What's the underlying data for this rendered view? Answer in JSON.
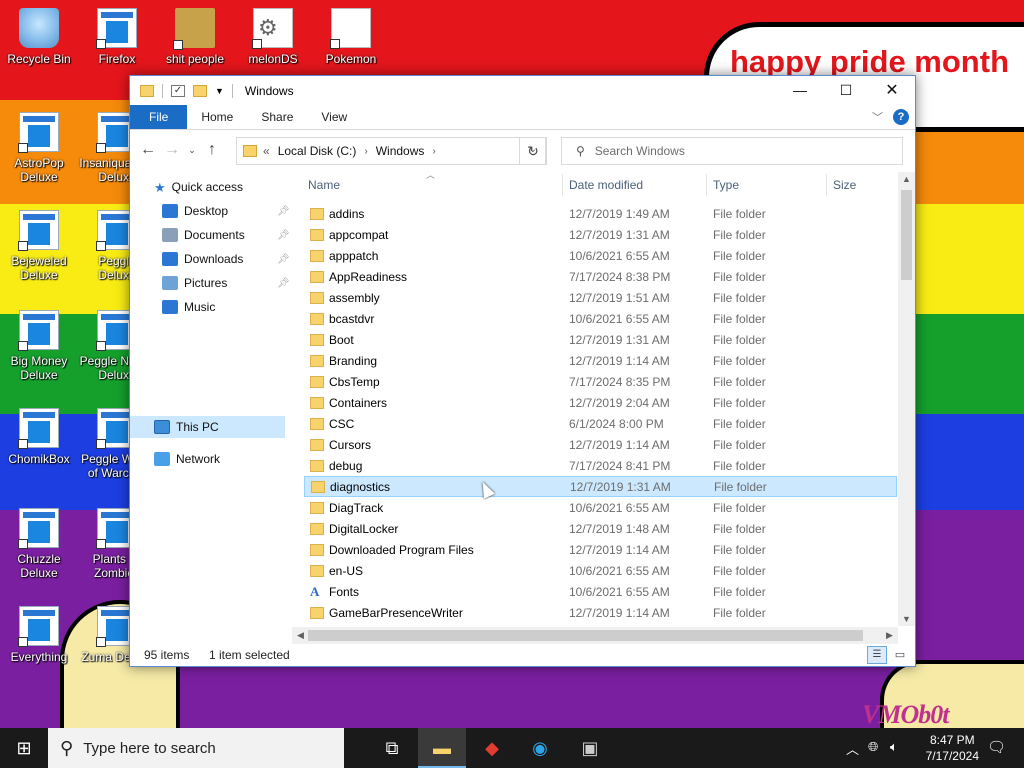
{
  "desktop": {
    "banner_text": "happy pride month",
    "watermark": "VMOb0t",
    "icons": [
      {
        "label": "Recycle Bin",
        "icon": "recycle-bin-icon"
      },
      {
        "label": "Firefox",
        "icon": "app-shortcut-icon"
      },
      {
        "label": "shit people",
        "icon": "folder-icon"
      },
      {
        "label": "melonDS",
        "icon": "gear-file-icon"
      },
      {
        "label": "Pokemon",
        "icon": "blank-file-icon"
      },
      {
        "label": "AstroPop\nDeluxe",
        "icon": "app-shortcut-icon"
      },
      {
        "label": "Insaniquarium\nDeluxe",
        "icon": "app-shortcut-icon"
      },
      {
        "label": "Bejeweled\nDeluxe",
        "icon": "app-shortcut-icon"
      },
      {
        "label": "Peggle\nDeluxe",
        "icon": "app-shortcut-icon"
      },
      {
        "label": "Big Money\nDeluxe",
        "icon": "app-shortcut-icon"
      },
      {
        "label": "Peggle Nights\nDeluxe",
        "icon": "app-shortcut-icon"
      },
      {
        "label": "ChomikBox",
        "icon": "app-shortcut-icon"
      },
      {
        "label": "Peggle World\nof Warcraft",
        "icon": "app-shortcut-icon"
      },
      {
        "label": "Chuzzle\nDeluxe",
        "icon": "app-shortcut-icon"
      },
      {
        "label": "Plants vs\nZombies",
        "icon": "app-shortcut-icon"
      },
      {
        "label": "Everything",
        "icon": "app-shortcut-icon"
      },
      {
        "label": "Zuma Deluxe",
        "icon": "app-shortcut-icon"
      }
    ]
  },
  "window": {
    "title": "Windows",
    "ribbon_tabs": [
      "File",
      "Home",
      "Share",
      "View"
    ],
    "address": {
      "root_chevron": "«",
      "crumbs": [
        "Local Disk (C:)",
        "Windows"
      ]
    },
    "search_placeholder": "Search Windows",
    "nav": {
      "quick_access": "Quick access",
      "items": [
        {
          "label": "Desktop",
          "pinned": true
        },
        {
          "label": "Documents",
          "pinned": true
        },
        {
          "label": "Downloads",
          "pinned": true
        },
        {
          "label": "Pictures",
          "pinned": true
        },
        {
          "label": "Music",
          "pinned": false
        }
      ],
      "this_pc": "This PC",
      "network": "Network"
    },
    "columns": {
      "name": "Name",
      "date": "Date modified",
      "type": "Type",
      "size": "Size"
    },
    "files": [
      {
        "name": "addins",
        "date": "12/7/2019 1:49 AM",
        "type": "File folder"
      },
      {
        "name": "appcompat",
        "date": "12/7/2019 1:31 AM",
        "type": "File folder"
      },
      {
        "name": "apppatch",
        "date": "10/6/2021 6:55 AM",
        "type": "File folder"
      },
      {
        "name": "AppReadiness",
        "date": "7/17/2024 8:38 PM",
        "type": "File folder"
      },
      {
        "name": "assembly",
        "date": "12/7/2019 1:51 AM",
        "type": "File folder"
      },
      {
        "name": "bcastdvr",
        "date": "10/6/2021 6:55 AM",
        "type": "File folder"
      },
      {
        "name": "Boot",
        "date": "12/7/2019 1:31 AM",
        "type": "File folder"
      },
      {
        "name": "Branding",
        "date": "12/7/2019 1:14 AM",
        "type": "File folder"
      },
      {
        "name": "CbsTemp",
        "date": "7/17/2024 8:35 PM",
        "type": "File folder"
      },
      {
        "name": "Containers",
        "date": "12/7/2019 2:04 AM",
        "type": "File folder"
      },
      {
        "name": "CSC",
        "date": "6/1/2024 8:00 PM",
        "type": "File folder"
      },
      {
        "name": "Cursors",
        "date": "12/7/2019 1:14 AM",
        "type": "File folder"
      },
      {
        "name": "debug",
        "date": "7/17/2024 8:41 PM",
        "type": "File folder"
      },
      {
        "name": "diagnostics",
        "date": "12/7/2019 1:31 AM",
        "type": "File folder",
        "selected": true
      },
      {
        "name": "DiagTrack",
        "date": "10/6/2021 6:55 AM",
        "type": "File folder"
      },
      {
        "name": "DigitalLocker",
        "date": "12/7/2019 1:48 AM",
        "type": "File folder"
      },
      {
        "name": "Downloaded Program Files",
        "date": "12/7/2019 1:14 AM",
        "type": "File folder"
      },
      {
        "name": "en-US",
        "date": "10/6/2021 6:55 AM",
        "type": "File folder"
      },
      {
        "name": "Fonts",
        "date": "10/6/2021 6:55 AM",
        "type": "File folder",
        "icon": "font"
      },
      {
        "name": "GameBarPresenceWriter",
        "date": "12/7/2019 1:14 AM",
        "type": "File folder"
      }
    ],
    "status": {
      "count": "95 items",
      "selection": "1 item selected"
    }
  },
  "taskbar": {
    "search_placeholder": "Type here to search",
    "time": "8:47 PM",
    "date": "7/17/2024"
  }
}
